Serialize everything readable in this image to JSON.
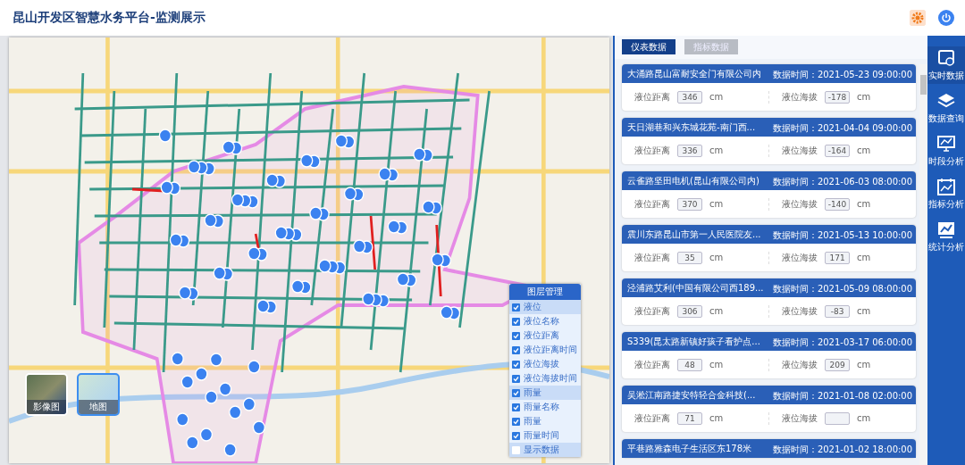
{
  "header": {
    "title": "昆山开发区智慧水务平台-监测展示"
  },
  "layer_panel": {
    "title": "图层管理",
    "groups": [
      {
        "label": "液位",
        "checked": true,
        "children": [
          {
            "label": "液位名称",
            "checked": true
          },
          {
            "label": "液位距离",
            "checked": true
          },
          {
            "label": "液位距离时间",
            "checked": true
          },
          {
            "label": "液位海拔",
            "checked": true
          },
          {
            "label": "液位海拔时间",
            "checked": true
          }
        ]
      },
      {
        "label": "雨量",
        "checked": true,
        "children": [
          {
            "label": "雨量名称",
            "checked": true
          },
          {
            "label": "雨量",
            "checked": true
          },
          {
            "label": "雨量时间",
            "checked": true
          }
        ]
      },
      {
        "label": "显示数据",
        "checked": false
      }
    ]
  },
  "basemaps": [
    {
      "label": "影像图",
      "selected": false
    },
    {
      "label": "地图",
      "selected": true
    }
  ],
  "tabs": [
    {
      "label": "仪表数据",
      "selected": true
    },
    {
      "label": "指标数据",
      "selected": false
    }
  ],
  "cards": [
    {
      "title": "大涌路昆山富耐安全门有限公司内",
      "time": "数据时间：2021-05-23 09:00:00",
      "distance_label": "液位距离",
      "distance": "346",
      "distance_unit": "cm",
      "altitude_label": "液位海拔",
      "altitude": "-178",
      "altitude_unit": "cm"
    },
    {
      "title": "天日湖巷和兴东城花苑-南门西...",
      "time": "数据时间：2021-04-04 09:00:00",
      "distance_label": "液位距离",
      "distance": "336",
      "distance_unit": "cm",
      "altitude_label": "液位海拔",
      "altitude": "-164",
      "altitude_unit": "cm"
    },
    {
      "title": "云雀路坚田电机(昆山有限公司内)",
      "time": "数据时间：2021-06-03 08:00:00",
      "distance_label": "液位距离",
      "distance": "370",
      "distance_unit": "cm",
      "altitude_label": "液位海拔",
      "altitude": "-140",
      "altitude_unit": "cm"
    },
    {
      "title": "震川东路昆山市第一人民医院友...",
      "time": "数据时间：2021-05-13 10:00:00",
      "distance_label": "液位距离",
      "distance": "35",
      "distance_unit": "cm",
      "altitude_label": "液位海拔",
      "altitude": "171",
      "altitude_unit": "cm"
    },
    {
      "title": "泾浦路艾利(中国有限公司西189...",
      "time": "数据时间：2021-05-09 08:00:00",
      "distance_label": "液位距离",
      "distance": "306",
      "distance_unit": "cm",
      "altitude_label": "液位海拔",
      "altitude": "-83",
      "altitude_unit": "cm"
    },
    {
      "title": "S339(昆太路新镇好孩子看护点...",
      "time": "数据时间：2021-03-17 06:00:00",
      "distance_label": "液位距离",
      "distance": "48",
      "distance_unit": "cm",
      "altitude_label": "液位海拔",
      "altitude": "209",
      "altitude_unit": "cm"
    },
    {
      "title": "吴淞江南路捷安特轻合金科技(...",
      "time": "数据时间：2021-01-08 02:00:00",
      "distance_label": "液位距离",
      "distance": "71",
      "distance_unit": "cm",
      "altitude_label": "液位海拔",
      "altitude_unit": "cm"
    },
    {
      "title": "平巷路雅森电子生活区东178米",
      "time": "数据时间：2021-01-02 18:00:00"
    }
  ],
  "side_nav": [
    {
      "label": "实时数据",
      "selected": true
    },
    {
      "label": "数据查询",
      "selected": false
    },
    {
      "label": "时段分析",
      "selected": false
    },
    {
      "label": "指标分析",
      "selected": false
    },
    {
      "label": "统计分析",
      "selected": false
    }
  ]
}
